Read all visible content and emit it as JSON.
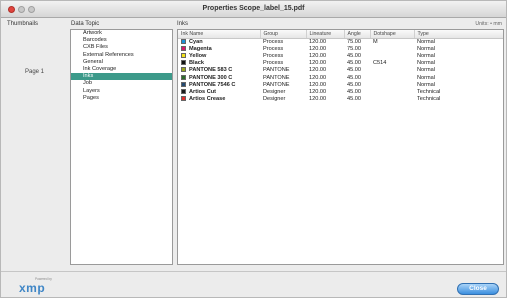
{
  "window": {
    "title": "Properties Scope_label_15.pdf"
  },
  "thumbnails": {
    "header": "Thumbnails",
    "page_label": "Page 1"
  },
  "data_topic": {
    "header": "Data Topic",
    "items": [
      {
        "label": "Artwork"
      },
      {
        "label": "Barcodes"
      },
      {
        "label": "CXB Files"
      },
      {
        "label": "External References"
      },
      {
        "label": "General"
      },
      {
        "label": "Ink Coverage"
      },
      {
        "label": "Inks"
      },
      {
        "label": "Job"
      },
      {
        "label": "Layers"
      },
      {
        "label": "Pages"
      }
    ],
    "selected_index": 6
  },
  "inks_panel": {
    "header": "Inks",
    "units_label": "Units: • mm",
    "columns": [
      "Ink Name",
      "Group",
      "Lineature",
      "Angle",
      "Dotshape",
      "Type"
    ],
    "rows": [
      {
        "color": "#1e8fd6",
        "name": "Cyan",
        "group": "Process",
        "lineature": "120.00",
        "angle": "75.00",
        "dotshape": "M",
        "type": "Normal"
      },
      {
        "color": "#d8186a",
        "name": "Magenta",
        "group": "Process",
        "lineature": "120.00",
        "angle": "75.00",
        "dotshape": "",
        "type": "Normal"
      },
      {
        "color": "#f2e21a",
        "name": "Yellow",
        "group": "Process",
        "lineature": "120.00",
        "angle": "45.00",
        "dotshape": "",
        "type": "Normal"
      },
      {
        "color": "#111111",
        "name": "Black",
        "group": "Process",
        "lineature": "120.00",
        "angle": "45.00",
        "dotshape": "C514",
        "type": "Normal"
      },
      {
        "color": "#9aa51c",
        "name": "PANTONE 583 C",
        "group": "PANTONE",
        "lineature": "120.00",
        "angle": "45.00",
        "dotshape": "",
        "type": "Normal"
      },
      {
        "color": "#2c6b2a",
        "name": "PANTONE 300 C",
        "group": "PANTONE",
        "lineature": "120.00",
        "angle": "45.00",
        "dotshape": "",
        "type": "Normal"
      },
      {
        "color": "#244a72",
        "name": "PANTONE 7546 C",
        "group": "PANTONE",
        "lineature": "120.00",
        "angle": "45.00",
        "dotshape": "",
        "type": "Normal"
      },
      {
        "color": "#1a1a1a",
        "name": "Artios Cut",
        "group": "Designer",
        "lineature": "120.00",
        "angle": "45.00",
        "dotshape": "",
        "type": "Technical"
      },
      {
        "color": "#e0302e",
        "name": "Artios Crease",
        "group": "Designer",
        "lineature": "120.00",
        "angle": "45.00",
        "dotshape": "",
        "type": "Technical"
      }
    ]
  },
  "footer": {
    "logo": "xmp",
    "tagline": "Powered by",
    "close_label": "Close"
  }
}
